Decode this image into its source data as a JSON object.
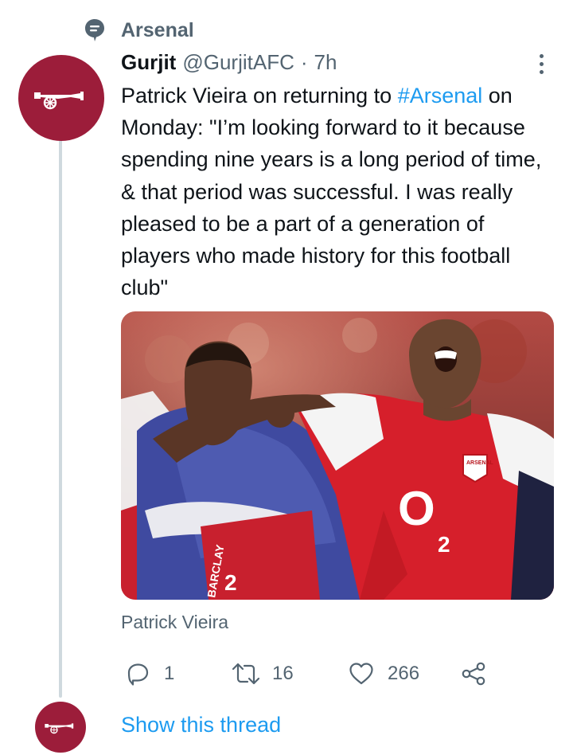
{
  "context": {
    "label": "Arsenal",
    "icon": "topic-icon"
  },
  "tweet": {
    "display_name": "Gurjit",
    "handle": "@GurjitAFC",
    "separator": "·",
    "time": "7h",
    "more_icon": "more-options-icon",
    "text_before": "Patrick Vieira on returning to ",
    "hashtag": "#Arsenal",
    "text_after": " on Monday: \"I’m looking forward to it because spending nine years is a long period of time, & that period was successful. I was really pleased to be a part of a generation of players who made history for this football club\"",
    "media_caption": "Patrick Vieira",
    "avatar_icon": "arsenal-cannon-icon"
  },
  "media_text": {
    "left_shirt": "BARCLAY",
    "left_sponsor": "2",
    "right_crest": "ARSENAL",
    "right_sponsor": "O",
    "right_sub": "2"
  },
  "actions": {
    "reply": {
      "icon": "reply-icon",
      "count": "1"
    },
    "retweet": {
      "icon": "retweet-icon",
      "count": "16"
    },
    "like": {
      "icon": "like-icon",
      "count": "266"
    },
    "share": {
      "icon": "share-icon"
    }
  },
  "thread": {
    "show_label": "Show this thread"
  },
  "colors": {
    "accent": "#1d9bf0",
    "secondary_text": "#536471",
    "thread_line": "#cfd9de",
    "arsenal_red": "#9c1d3a"
  }
}
